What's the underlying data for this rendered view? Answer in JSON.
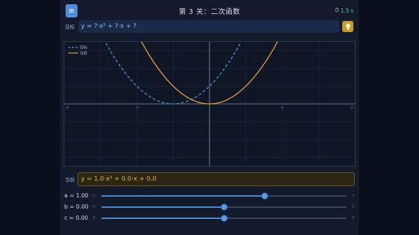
{
  "header": {
    "title": "第 3 关：二次函数",
    "timer": "1.5 s"
  },
  "target": {
    "label": "目标",
    "formula": "y = ?·x² + ?·x + ?"
  },
  "current": {
    "label": "当前",
    "formula": "y = 1.0·x² + 0.0·x + 0.0"
  },
  "graph": {
    "legend": {
      "target": "目标",
      "current": "当前"
    },
    "x_ticks": [
      "-8",
      "-4",
      "4",
      "8"
    ],
    "x_range": [
      -8,
      8
    ],
    "y_range": [
      -3.5,
      3.5
    ],
    "colors": {
      "target": "#3f97e0",
      "current": "#f2a03a",
      "axis": "#8c97ad",
      "grid": "#1e2940"
    },
    "target_curve": {
      "a": 0.25,
      "b": 1.0,
      "c": 1.0
    },
    "current_curve": {
      "a": 0.25,
      "b": 0.0,
      "c": 0.0
    }
  },
  "sliders": [
    {
      "label": "a = 1.00",
      "min": "-3",
      "max": "3",
      "fraction": 0.667
    },
    {
      "label": "b = 0.00",
      "min": "-5",
      "max": "5",
      "fraction": 0.5
    },
    {
      "label": "c = 0.00",
      "min": "-8",
      "max": "8",
      "fraction": 0.5
    }
  ]
}
